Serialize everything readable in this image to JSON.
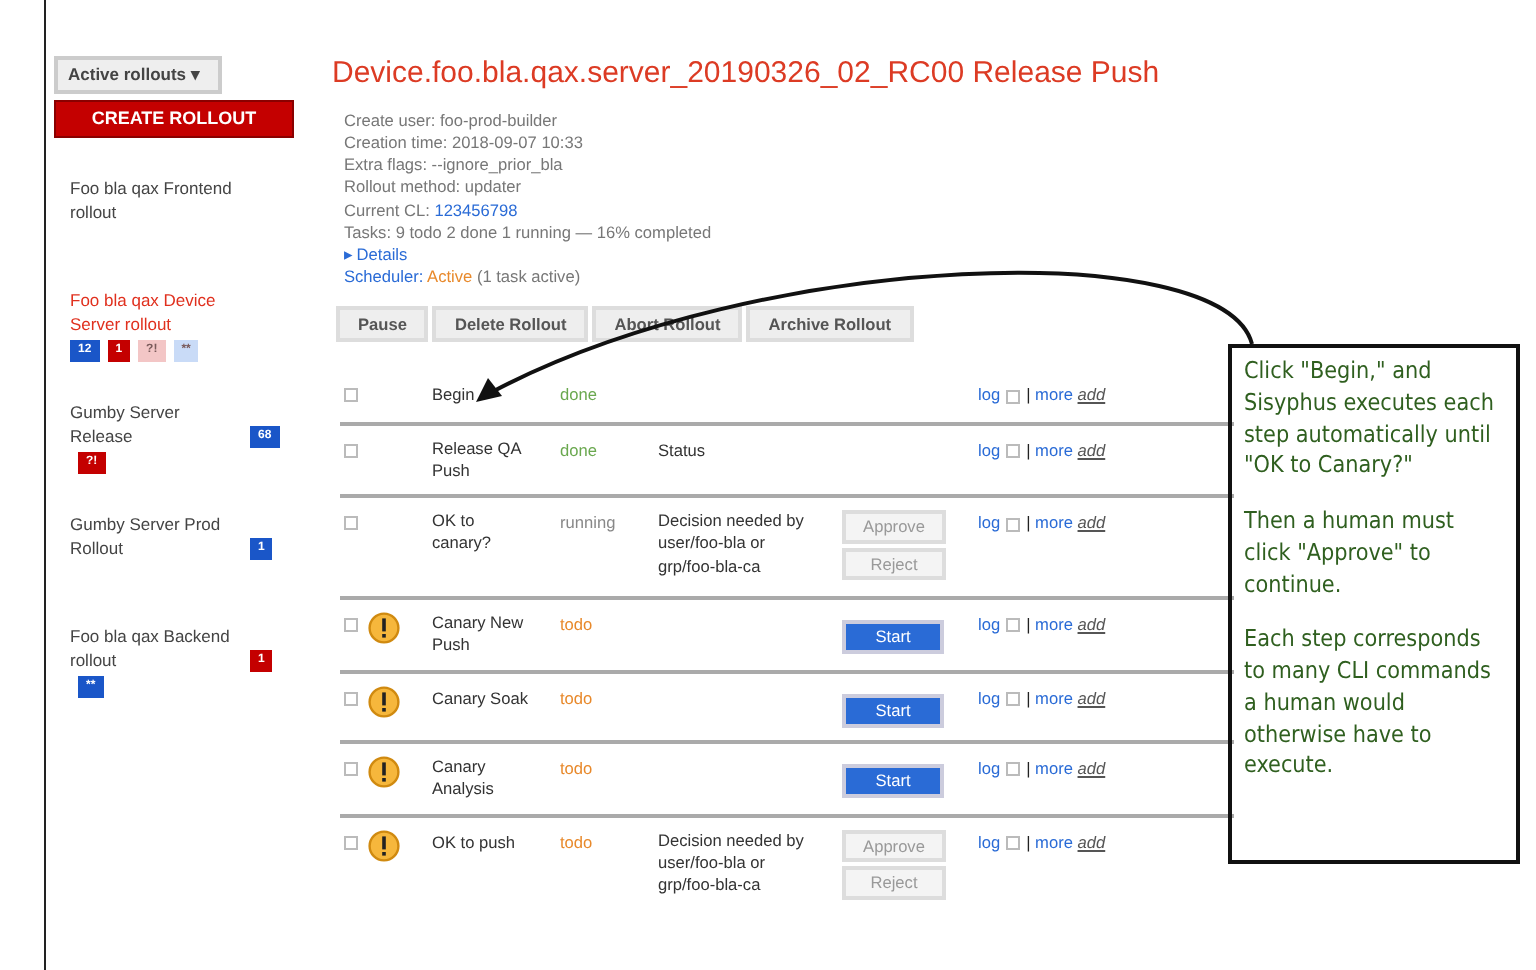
{
  "sidebar": {
    "dropdown": {
      "label": "Active rollouts",
      "caret": "▾"
    },
    "create_button": "CREATE ROLLOUT",
    "rollouts": [
      {
        "name": "Foo bla qax Frontend rollout",
        "selected": false
      },
      {
        "name": "Foo bla qax Device Server rollout",
        "selected": true,
        "badges": [
          {
            "text": "12",
            "color": "#1a56c8"
          },
          {
            "text": "1",
            "color": "#c40000"
          },
          {
            "text": "?!",
            "color": "#f3c6c6"
          },
          {
            "text": "**",
            "color": "#c9dbf7"
          }
        ]
      },
      {
        "name": "Gumby Server Release",
        "selected": false,
        "badges": [
          {
            "text": "68",
            "color": "#1a56c8"
          },
          {
            "text": "?!",
            "color": "#c40000"
          }
        ]
      },
      {
        "name": "Gumby Server Prod Rollout",
        "selected": false,
        "badges": [
          {
            "text": "1",
            "color": "#1a56c8"
          }
        ]
      },
      {
        "name": "Foo bla qax Backend rollout",
        "selected": false,
        "badges": [
          {
            "text": "1",
            "color": "#c40000"
          },
          {
            "text": "**",
            "color": "#1a56c8"
          }
        ]
      }
    ]
  },
  "rollout": {
    "title": "Device.foo.bla.qax.server_20190326_02_RC00 Release Push",
    "info": [
      {
        "label": "Create user:",
        "value": "foo-prod-builder",
        "kind": "text"
      },
      {
        "label": "Creation time:",
        "value": "2018-09-07 10:33",
        "kind": "text"
      },
      {
        "label": "Extra flags:",
        "value": "--ignore_prior_bla",
        "kind": "text"
      },
      {
        "label": "Rollout method:",
        "value": "updater",
        "kind": "text"
      },
      {
        "label": "Current CL:",
        "value": "123456798",
        "kind": "link"
      },
      {
        "label": "Tasks:",
        "value": "9 todo 2 done 1 running  — 16% completed",
        "kind": "text"
      }
    ],
    "details": {
      "toggle": "▸",
      "label": "Details",
      "expanded": false
    },
    "scheduler": {
      "label": "Scheduler:",
      "state": "Active",
      "note": "(1 task active)"
    },
    "buttons": [
      "Pause",
      "Delete Rollout",
      "Abort Rollout",
      "Archive Rollout"
    ]
  },
  "steps": [
    {
      "name": "Begin",
      "status": "done",
      "warning": false,
      "checked": false,
      "links": {
        "log": "log",
        "log_checked": false,
        "separator": "|",
        "more": "more",
        "add": "add"
      }
    },
    {
      "name": "Release QA Push",
      "status": "done",
      "warning": false,
      "checked": false,
      "description": "Status",
      "links": {
        "log": "log",
        "log_checked": false,
        "separator": "|",
        "more": "more",
        "add": "add"
      }
    },
    {
      "name": "OK to canary?",
      "status": "running",
      "warning": false,
      "checked": false,
      "description": "Decision needed by user/foo-bla or grp/foo-bla-ca",
      "buttons": [
        {
          "label": "Approve",
          "kind": "approve"
        },
        {
          "label": "Reject",
          "kind": "reject"
        }
      ],
      "links": {
        "log": "log",
        "log_checked": false,
        "separator": "|",
        "more": "more",
        "add": "add"
      }
    },
    {
      "name": "Canary New Push",
      "status": "todo",
      "warning": true,
      "checked": false,
      "buttons": [
        {
          "label": "Start",
          "kind": "start"
        }
      ],
      "links": {
        "log": "log",
        "log_checked": false,
        "separator": "|",
        "more": "more",
        "add": "add"
      }
    },
    {
      "name": "Canary Soak",
      "status": "todo",
      "warning": true,
      "checked": false,
      "buttons": [
        {
          "label": "Start",
          "kind": "start"
        }
      ],
      "links": {
        "log": "log",
        "log_checked": false,
        "separator": "|",
        "more": "more",
        "add": "add"
      }
    },
    {
      "name": "Canary Analysis",
      "status": "todo",
      "warning": true,
      "checked": false,
      "buttons": [
        {
          "label": "Start",
          "kind": "start"
        }
      ],
      "links": {
        "log": "log",
        "log_checked": false,
        "separator": "|",
        "more": "more",
        "add": "add"
      }
    },
    {
      "name": "OK to push",
      "status": "todo",
      "warning": true,
      "checked": false,
      "description": "Decision needed by user/foo-bla or grp/foo-bla-ca",
      "buttons": [
        {
          "label": "Approve",
          "kind": "approve"
        },
        {
          "label": "Reject",
          "kind": "reject"
        }
      ],
      "links": {
        "log": "log",
        "log_checked": false,
        "separator": "|",
        "more": "more",
        "add": "add"
      }
    }
  ],
  "callout": {
    "paragraphs": [
      "Click \"Begin,\" and Sisyphus executes each step automatically until \"OK to Canary?\"",
      "Then a human must click \"Approve\" to continue.",
      "Each step corresponds to many CLI commands a human would otherwise have to execute."
    ]
  }
}
